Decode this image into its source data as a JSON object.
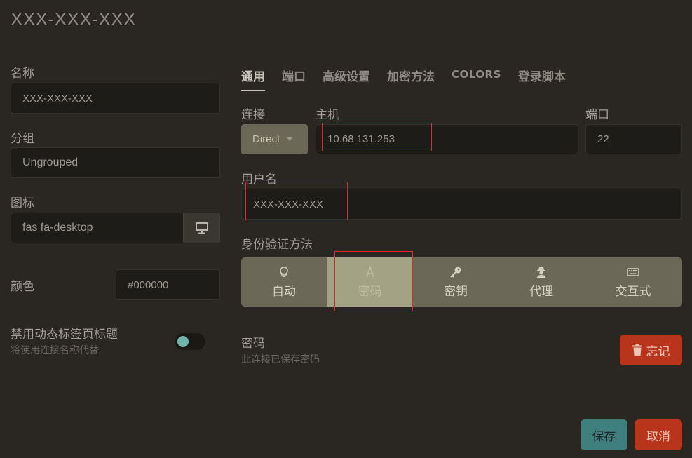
{
  "window": {
    "title": "XXX-XXX-XXX"
  },
  "left": {
    "name_label": "名称",
    "name_value": "XXX-XXX-XXX",
    "group_label": "分组",
    "group_value": "Ungrouped",
    "icon_label": "图标",
    "icon_value": "fas fa-desktop",
    "icon_button": "desktop-icon",
    "color_label": "颜色",
    "color_value": "#000000",
    "disable_title_label": "禁用动态标签页标题",
    "disable_title_hint": "将使用连接名称代替",
    "disable_title_toggle": true
  },
  "tabs": [
    {
      "label": "通用",
      "active": true
    },
    {
      "label": "端口",
      "active": false
    },
    {
      "label": "高级设置",
      "active": false
    },
    {
      "label": "加密方法",
      "active": false
    },
    {
      "label": "COLORS",
      "active": false
    },
    {
      "label": "登录脚本",
      "active": false
    }
  ],
  "general": {
    "connection_label": "连接",
    "connection_value": "Direct",
    "host_label": "主机",
    "host_value": "10.68.131.253",
    "port_label": "端口",
    "port_value": "22",
    "username_label": "用户名",
    "username_value": "XXX-XXX-XXX",
    "auth_label": "身份验证方法",
    "auth_options": [
      {
        "label": "自动",
        "icon": "lightbulb-icon",
        "active": false
      },
      {
        "label": "密码",
        "icon": "font-icon",
        "active": true
      },
      {
        "label": "密钥",
        "icon": "key-icon",
        "active": false
      },
      {
        "label": "代理",
        "icon": "user-secret-icon",
        "active": false
      },
      {
        "label": "交互式",
        "icon": "keyboard-icon",
        "active": false
      }
    ],
    "password_label": "密码",
    "password_hint": "此连接已保存密码",
    "forget_label": "忘记"
  },
  "footer": {
    "save_label": "保存",
    "cancel_label": "取消"
  },
  "colors": {
    "accent_teal": "#3f7f7e",
    "danger": "#b8341a",
    "highlight": "#e0282e"
  }
}
